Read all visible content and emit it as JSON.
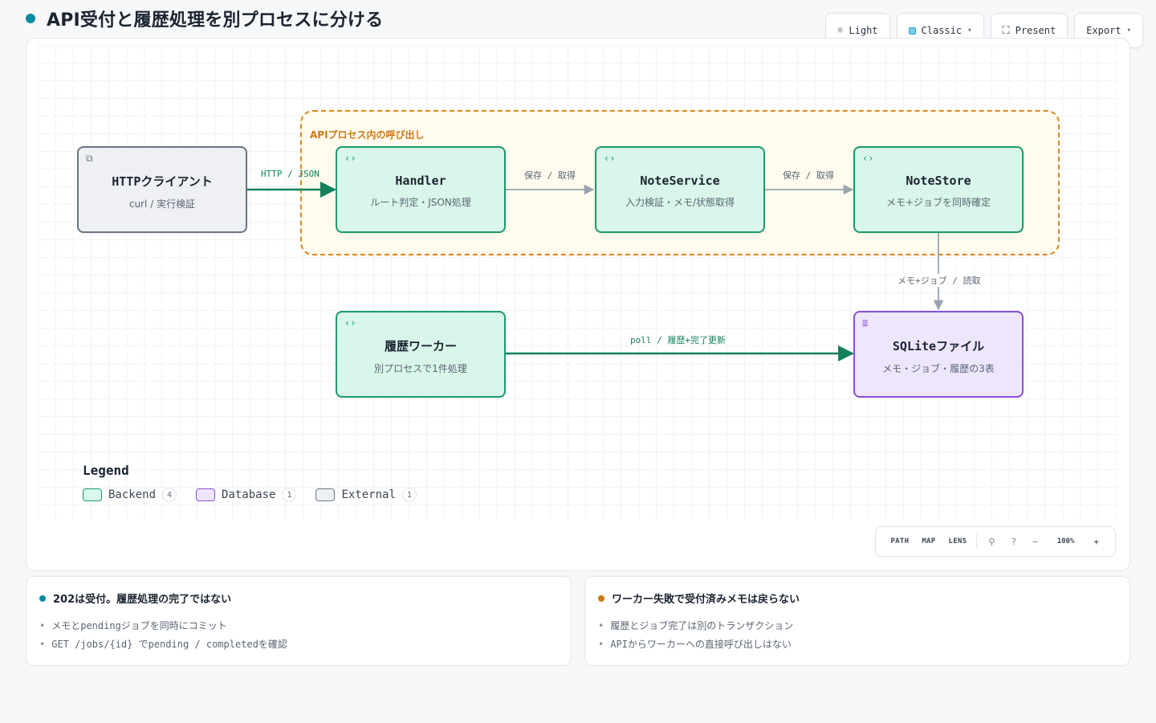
{
  "header": {
    "title": "API受付と履歴処理を別プロセスに分ける"
  },
  "toolbar": {
    "theme_label": "Light",
    "style_label": "Classic",
    "present_label": "Present",
    "export_label": "Export"
  },
  "diagram": {
    "group": {
      "label": "APIプロセス内の呼び出し"
    },
    "nodes": {
      "client": {
        "title": "HTTPクライアント",
        "subtitle": "curl / 実行検証",
        "kind": "External"
      },
      "handler": {
        "title": "Handler",
        "subtitle": "ルート判定・JSON処理",
        "kind": "Backend"
      },
      "service": {
        "title": "NoteService",
        "subtitle": "入力検証・メモ/状態取得",
        "kind": "Backend"
      },
      "store": {
        "title": "NoteStore",
        "subtitle": "メモ+ジョブを同時確定",
        "kind": "Backend"
      },
      "worker": {
        "title": "履歴ワーカー",
        "subtitle": "別プロセスで1件処理",
        "kind": "Backend"
      },
      "sqlite": {
        "title": "SQLiteファイル",
        "subtitle": "メモ・ジョブ・履歴の3表",
        "kind": "Database"
      }
    },
    "edges": {
      "client_handler": "HTTP / JSON",
      "handler_service": "保存 / 取得",
      "service_store": "保存 / 取得",
      "store_sqlite": "メモ+ジョブ / 読取",
      "worker_sqlite": "poll / 履歴+完了更新"
    },
    "colors": {
      "backend": "#1b9a6c",
      "database": "#8b4fd6",
      "external": "#6b7585",
      "group": "#d98a1e",
      "edge_grey": "#9aa3b0"
    }
  },
  "legend": {
    "title": "Legend",
    "items": [
      {
        "label": "Backend",
        "count": "4",
        "color": "#1b9a6c",
        "fill": "#d9f6ea"
      },
      {
        "label": "Database",
        "count": "1",
        "color": "#8b4fd6",
        "fill": "#ede6fd"
      },
      {
        "label": "External",
        "count": "1",
        "color": "#6b7585",
        "fill": "#eef0f4"
      }
    ]
  },
  "zoombar": {
    "path": "PATH",
    "map": "MAP",
    "lens": "LENS",
    "zoom": "100%"
  },
  "notes": [
    {
      "title": "202は受付。履歴処理の完了ではない",
      "color": "#0b8aa3",
      "items": [
        "メモとpendingジョブを同時にコミット",
        "GET /jobs/{id} でpending / completedを確認"
      ]
    },
    {
      "title": "ワーカー失敗で受付済みメモは戻らない",
      "color": "#d0780f",
      "items": [
        "履歴とジョブ完了は別のトランザクション",
        "APIからワーカーへの直接呼び出しはない"
      ]
    }
  ]
}
